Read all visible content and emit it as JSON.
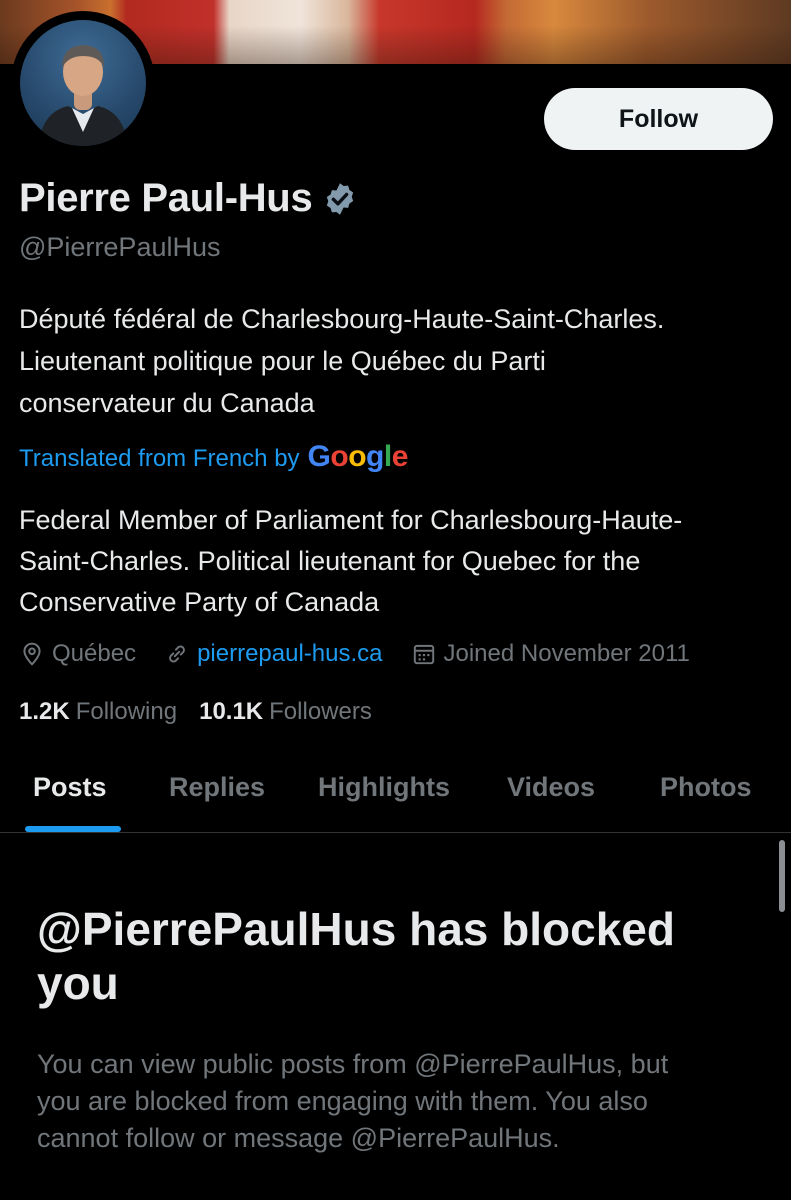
{
  "profile": {
    "follow_label": "Follow",
    "name": "Pierre Paul-Hus",
    "handle": "@PierrePaulHus",
    "bio_lines": [
      "Député fédéral de Charlesbourg-Haute-Saint-Charles.",
      "Lieutenant politique pour le Québec du Parti",
      "conservateur du Canada"
    ],
    "translated_label": "Translated from French by",
    "translated_by": "Google",
    "bio_translated_lines": [
      "Federal Member of Parliament for Charlesbourg-Haute-",
      "Saint-Charles. Political lieutenant for Quebec for the",
      "Conservative Party of Canada"
    ],
    "location": "Québec",
    "website": "pierrepaul-hus.ca",
    "joined": "Joined November 2011",
    "following_count": "1.2K",
    "following_label": "Following",
    "followers_count": "10.1K",
    "followers_label": "Followers"
  },
  "tabs": [
    "Posts",
    "Replies",
    "Highlights",
    "Videos",
    "Photos"
  ],
  "active_tab": "Posts",
  "blocked": {
    "title_lines": [
      "@PierrePaulHus has blocked",
      "you"
    ],
    "message_lines": [
      "You can view public posts from @PierrePaulHus, but",
      "you are blocked from engaging with them. You also",
      "cannot follow or message @PierrePaulHus."
    ]
  },
  "icons": {
    "verified": "verified-badge-icon",
    "location": "location-pin-icon",
    "link": "link-icon",
    "calendar": "calendar-icon"
  },
  "colors": {
    "background": "#000000",
    "text_primary": "#e7e9ea",
    "text_secondary": "#71767b",
    "accent": "#1d9bf0",
    "follow_button_bg": "#eff3f4"
  }
}
